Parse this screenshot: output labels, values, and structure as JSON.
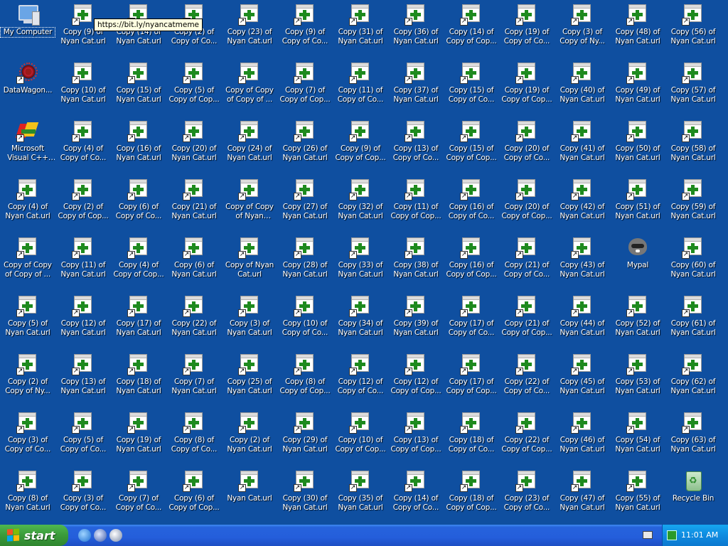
{
  "desktop": {
    "columns": [
      [
        "My Computer",
        "DataWagon...",
        "Microsoft Visual C++ 6.0",
        "Copy (4) of Nyan Cat.url",
        "Copy of Copy of Copy of ...",
        "Copy (5) of Nyan Cat.url",
        "Copy (2) of Copy of Ny...",
        "Copy (3) of Copy of Co...",
        "Copy (8) of Nyan Cat.url"
      ],
      [
        "Copy (9) of Nyan Cat.url",
        "Copy (10) of Nyan Cat.url",
        "Copy (4) of Copy of Co...",
        "Copy (2) of Copy of Cop...",
        "Copy (11) of Nyan Cat.url",
        "Copy (12) of Nyan Cat.url",
        "Copy (13) of Nyan Cat.url",
        "Copy (5) of Copy of Co...",
        "Copy (3) of Copy of Co..."
      ],
      [
        "Copy (14) of Nyan Cat.url",
        "Copy (15) of Nyan Cat.url",
        "Copy (16) of Nyan Cat.url",
        "Copy (6) of Copy of Co...",
        "Copy (4) of Copy of Cop...",
        "Copy (17) of Nyan Cat.url",
        "Copy (18) of Nyan Cat.url",
        "Copy (19) of Nyan Cat.url",
        "Copy (7) of Copy of Co..."
      ],
      [
        "Copy (2) of Copy of Co...",
        "Copy (5) of Copy of Cop...",
        "Copy (20) of Nyan Cat.url",
        "Copy (21) of Nyan Cat.url",
        "Copy (6) of Nyan Cat.url",
        "Copy (22) of Nyan Cat.url",
        "Copy (7) of Nyan Cat.url",
        "Copy (8) of Copy of Co...",
        "Copy (6) of Copy of Cop..."
      ],
      [
        "Copy (23) of Nyan Cat.url",
        "Copy of Copy of Copy of ...",
        "Copy (24) of Nyan Cat.url",
        "Copy of Copy of Nyan Cat.url",
        "Copy of Nyan Cat.url",
        "Copy (3) of Nyan Cat.url",
        "Copy (25) of Nyan Cat.url",
        "Copy (2) of Nyan Cat.url",
        "Nyan Cat.url"
      ],
      [
        "Copy (9) of Copy of Co...",
        "Copy (7) of Copy of Cop...",
        "Copy (26) of Nyan Cat.url",
        "Copy (27) of Nyan Cat.url",
        "Copy (28) of Nyan Cat.url",
        "Copy (10) of Copy of Co...",
        "Copy (8) of Copy of Cop...",
        "Copy (29) of Nyan Cat.url",
        "Copy (30) of Nyan Cat.url"
      ],
      [
        "Copy (31) of Nyan Cat.url",
        "Copy (11) of Copy of Co...",
        "Copy (9) of Copy of Cop...",
        "Copy (32) of Nyan Cat.url",
        "Copy (33) of Nyan Cat.url",
        "Copy (34) of Nyan Cat.url",
        "Copy (12) of Copy of Co...",
        "Copy (10) of Copy of Cop...",
        "Copy (35) of Nyan Cat.url"
      ],
      [
        "Copy (36) of Nyan Cat.url",
        "Copy (37) of Nyan Cat.url",
        "Copy (13) of Copy of Co...",
        "Copy (11) of Copy of Cop...",
        "Copy (38) of Nyan Cat.url",
        "Copy (39) of Nyan Cat.url",
        "Copy (12) of Copy of Cop...",
        "Copy (13) of Copy of Cop...",
        "Copy (14) of Copy of Co..."
      ],
      [
        "Copy (14) of Copy of Cop...",
        "Copy (15) of Copy of Co...",
        "Copy (15) of Copy of Cop...",
        "Copy (16) of Copy of Co...",
        "Copy (16) of Copy of Cop...",
        "Copy (17) of Copy of Co...",
        "Copy (17) of Copy of Cop...",
        "Copy (18) of Copy of Co...",
        "Copy (18) of Copy of Cop..."
      ],
      [
        "Copy (19) of Copy of Co...",
        "Copy (19) of Copy of Cop...",
        "Copy (20) of Copy of Co...",
        "Copy (20) of Copy of Cop...",
        "Copy (21) of Copy of Co...",
        "Copy (21) of Copy of Cop...",
        "Copy (22) of Copy of Co...",
        "Copy (22) of Copy of Cop...",
        "Copy (23) of Copy of Co..."
      ],
      [
        "Copy (3) of Copy of Ny...",
        "Copy (40) of Nyan Cat.url",
        "Copy (41) of Nyan Cat.url",
        "Copy (42) of Nyan Cat.url",
        "Copy (43) of Nyan Cat.url",
        "Copy (44) of Nyan Cat.url",
        "Copy (45) of Nyan Cat.url",
        "Copy (46) of Nyan Cat.url",
        "Copy (47) of Nyan Cat.url"
      ],
      [
        "Copy (48) of Nyan Cat.url",
        "Copy (49) of Nyan Cat.url",
        "Copy (50) of Nyan Cat.url",
        "Copy (51) of Nyan Cat.url",
        "Mypal",
        "Copy (52) of Nyan Cat.url",
        "Copy (53) of Nyan Cat.url",
        "Copy (54) of Nyan Cat.url",
        "Copy (55) of Nyan Cat.url"
      ],
      [
        "Copy (56) of Nyan Cat.url",
        "Copy (57) of Nyan Cat.url",
        "Copy (58) of Nyan Cat.url",
        "Copy (59) of Nyan Cat.url",
        "Copy (60) of Nyan Cat.url",
        "Copy (61) of Nyan Cat.url",
        "Copy (62) of Nyan Cat.url",
        "Copy (63) of Nyan Cat.url",
        "Recycle Bin"
      ]
    ],
    "special_icons": {
      "My Computer": "computer-icon",
      "DataWagon...": "datawagon-icon",
      "Microsoft Visual C++ 6.0": "visual-cpp-icon",
      "Mypal": "mypal-icon",
      "Recycle Bin": "recycle-bin-icon"
    },
    "selected": "My Computer",
    "background_color": "#0f4fa0"
  },
  "tooltip": {
    "text": "https://bit.ly/nyancatmeme"
  },
  "taskbar": {
    "start_label": "start",
    "quick_launch": [
      "internet-explorer-icon",
      "media-player-icon",
      "show-desktop-icon"
    ],
    "clock": "11:01 AM"
  }
}
